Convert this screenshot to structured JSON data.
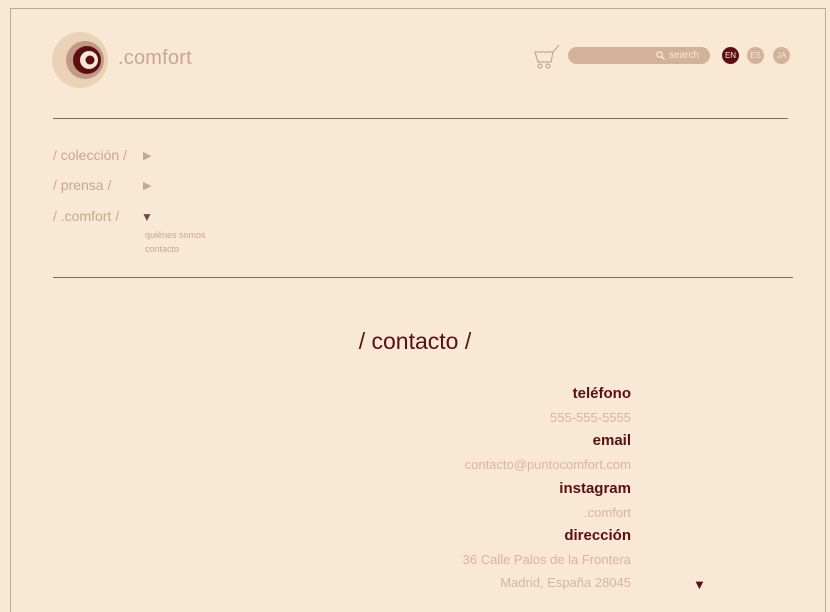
{
  "header": {
    "brand": ".comfort",
    "search_placeholder": "search",
    "languages": [
      "EN",
      "ES",
      "JA"
    ],
    "active_language": "EN"
  },
  "nav": {
    "items": [
      {
        "label": "/ colección /"
      },
      {
        "label": "/ prensa /"
      },
      {
        "label": "/ .comfort /"
      }
    ],
    "submenu": [
      "quiénes somos",
      "contacto"
    ]
  },
  "page": {
    "title": "/ contacto /"
  },
  "contact": {
    "phone_label": "teléfono",
    "phone_value": "555-555-5555",
    "email_label": "email",
    "email_value": "contacto@puntocomfort.com",
    "instagram_label": "instagram",
    "instagram_value": ".comfort",
    "address_label": "dirección",
    "address_line1": "36 Calle Palos de la Frontera",
    "address_line2": "Madrid, España 28045"
  },
  "colors": {
    "background": "#f8e8d4",
    "accent": "#5b0f14",
    "muted": "#c9a78f"
  }
}
